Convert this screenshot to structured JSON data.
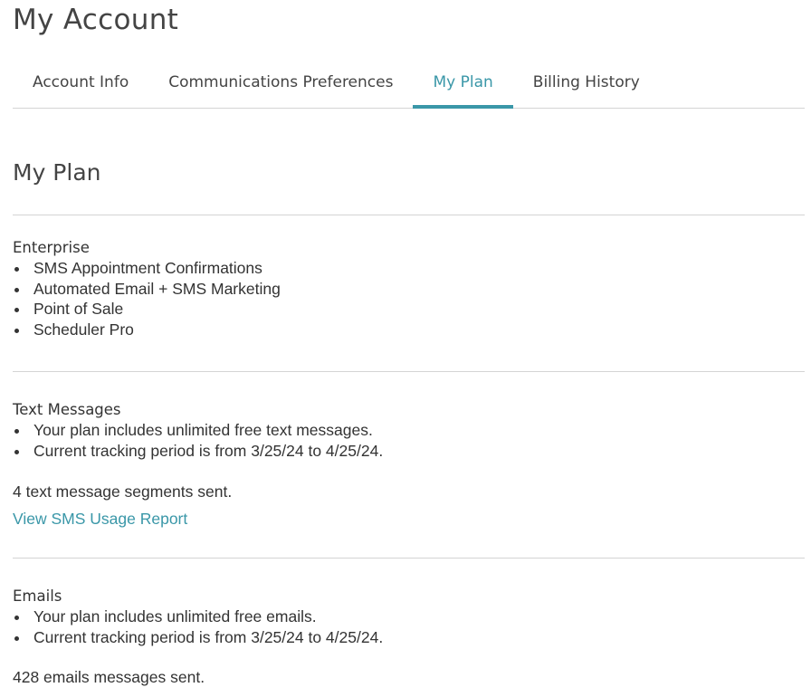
{
  "page": {
    "title": "My Account"
  },
  "tabs": [
    {
      "label": "Account Info",
      "active": false
    },
    {
      "label": "Communications Preferences",
      "active": false
    },
    {
      "label": "My Plan",
      "active": true
    },
    {
      "label": "Billing History",
      "active": false
    }
  ],
  "plan": {
    "section_title": "My Plan",
    "name": "Enterprise",
    "features": [
      "SMS Appointment Confirmations",
      "Automated Email + SMS Marketing",
      "Point of Sale",
      "Scheduler Pro"
    ]
  },
  "text_messages": {
    "title": "Text Messages",
    "items": [
      "Your plan includes unlimited free text messages.",
      "Current tracking period is from 3/25/24 to 4/25/24."
    ],
    "sent_text": "4 text message segments sent.",
    "report_link": "View SMS Usage Report"
  },
  "emails": {
    "title": "Emails",
    "items": [
      "Your plan includes unlimited free emails.",
      "Current tracking period is from 3/25/24 to 4/25/24."
    ],
    "sent_text": "428 emails messages sent."
  },
  "colors": {
    "accent": "#3a97a8",
    "text": "#333333",
    "divider": "#d4d4d4"
  }
}
